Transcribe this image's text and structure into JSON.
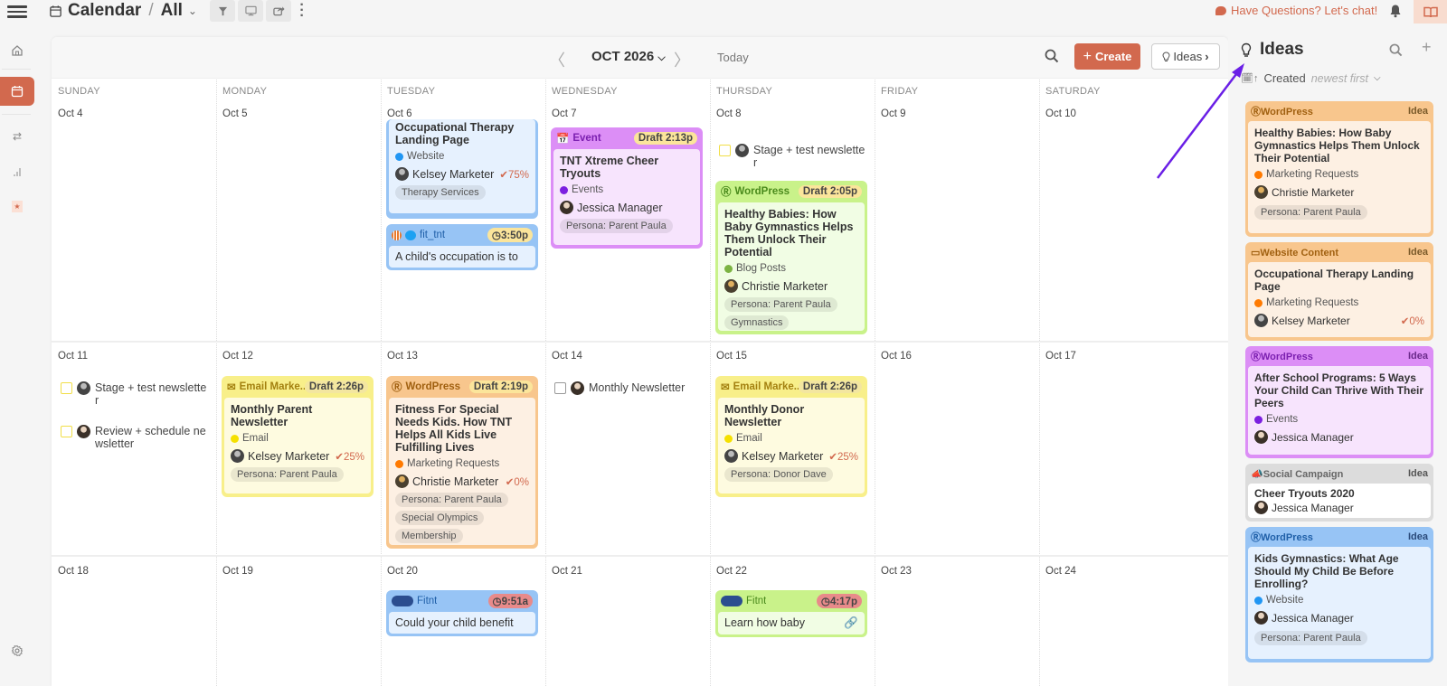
{
  "topbar": {
    "section": "Calendar",
    "filter": "All",
    "chat_label": "Have Questions? Let's chat!"
  },
  "toolbar": {
    "month_label": "OCT 2026",
    "today_label": "Today",
    "create_label": "Create",
    "ideas_label": "Ideas"
  },
  "weekdays": [
    "SUNDAY",
    "MONDAY",
    "TUESDAY",
    "WEDNESDAY",
    "THURSDAY",
    "FRIDAY",
    "SATURDAY"
  ],
  "weeks": [
    [
      "Oct 4",
      "Oct 5",
      "Oct 6",
      "Oct 7",
      "Oct 8",
      "Oct 9",
      "Oct 10"
    ],
    [
      "Oct 11",
      "Oct 12",
      "Oct 13",
      "Oct 14",
      "Oct 15",
      "Oct 16",
      "Oct 17"
    ],
    [
      "Oct 18",
      "Oct 19",
      "Oct 20",
      "Oct 21",
      "Oct 22",
      "Oct 23",
      "Oct 24"
    ]
  ],
  "cards": {
    "oct6_web": {
      "title": "Occupational Therapy Landing Page",
      "category": "Website",
      "category_color": "#2196f3",
      "person": "Kelsey Marketer",
      "progress": "75%",
      "tags": [
        "Therapy Services"
      ]
    },
    "oct6_social": {
      "account": "fit_tnt",
      "time": "3:50p",
      "snippet": "A child's occupation is to"
    },
    "oct7_event": {
      "type": "Event",
      "status": "Draft",
      "time": "2:13p",
      "title": "TNT Xtreme Cheer Tryouts",
      "category": "Events",
      "category_color": "#7c1fe0",
      "person": "Jessica Manager",
      "tags": [
        "Persona: Parent Paula"
      ]
    },
    "oct8_task": {
      "label": "Stage + test newsletter"
    },
    "oct8_wp": {
      "type": "WordPress",
      "status": "Draft",
      "time": "2:05p",
      "title": "Healthy Babies: How Baby Gymnastics Helps Them Unlock Their Potential",
      "category": "Blog Posts",
      "category_color": "#7cb342",
      "person": "Christie Marketer",
      "tags": [
        "Persona: Parent Paula",
        "Gymnastics"
      ]
    },
    "oct11_task1": {
      "label": "Stage + test newsletter"
    },
    "oct11_task2": {
      "label": "Review + schedule newsletter"
    },
    "oct12_email": {
      "type": "Email Marke...",
      "status": "Draft",
      "time": "2:26p",
      "title": "Monthly Parent Newsletter",
      "category": "Email",
      "category_color": "#f5e000",
      "person": "Kelsey Marketer",
      "progress": "25%",
      "tags": [
        "Persona: Parent Paula"
      ]
    },
    "oct13_wp": {
      "type": "WordPress",
      "status": "Draft",
      "time": "2:19p",
      "title": "Fitness For Special Needs Kids. How TNT Helps All Kids Live Fulfilling Lives",
      "category": "Marketing Requests",
      "category_color": "#ff7a00",
      "person": "Christie Marketer",
      "progress": "0%",
      "tags": [
        "Persona: Parent Paula",
        "Special Olympics",
        "Membership"
      ]
    },
    "oct14_task": {
      "label": "Monthly Newsletter"
    },
    "oct15_email": {
      "type": "Email Marke...",
      "status": "Draft",
      "time": "2:26p",
      "title": "Monthly Donor Newsletter",
      "category": "Email",
      "category_color": "#f5e000",
      "person": "Kelsey Marketer",
      "progress": "25%",
      "tags": [
        "Persona: Donor Dave"
      ]
    },
    "oct20_social": {
      "account": "Fitnt",
      "time": "9:51a",
      "snippet": "Could your child benefit"
    },
    "oct22_social": {
      "account": "Fitnt",
      "time": "4:17p",
      "snippet": "Learn how baby"
    }
  },
  "ideas": {
    "title": "Ideas",
    "sort_label": "Created",
    "sort_direction": "newest first",
    "items": [
      {
        "type": "WordPress",
        "badge": "Idea",
        "title": "Healthy Babies: How Baby Gymnastics Helps Them Unlock Their Potential",
        "category": "Marketing Requests",
        "category_color": "#ff7a00",
        "person": "Christie Marketer",
        "tags": [
          "Persona: Parent Paula"
        ]
      },
      {
        "type": "Website Content",
        "badge": "Idea",
        "title": "Occupational Therapy Landing Page",
        "category": "Marketing Requests",
        "category_color": "#ff7a00",
        "person": "Kelsey Marketer",
        "progress": "0%"
      },
      {
        "type": "WordPress",
        "badge": "Idea",
        "title": "After School Programs: 5 Ways Your Child Can Thrive With Their Peers",
        "category": "Events",
        "category_color": "#7c1fe0",
        "person": "Jessica Manager"
      },
      {
        "type": "Social Campaign",
        "badge": "Idea",
        "title": "Cheer Tryouts 2020",
        "person": "Jessica Manager"
      },
      {
        "type": "WordPress",
        "badge": "Idea",
        "title": "Kids Gymnastics: What Age Should My Child Be Before Enrolling?",
        "category": "Website",
        "category_color": "#2196f3",
        "person": "Jessica Manager",
        "tags": [
          "Persona: Parent Paula"
        ]
      }
    ]
  },
  "colors": {
    "accent": "#d2694e",
    "annotation_arrow": "#6a1fe6"
  }
}
